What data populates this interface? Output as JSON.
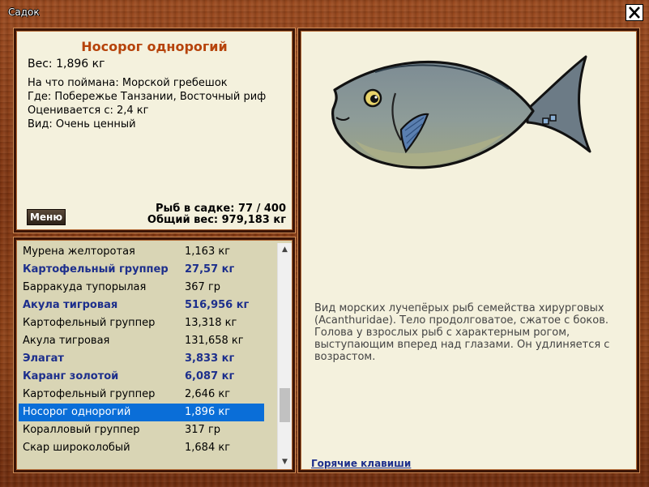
{
  "window": {
    "title": "Садок",
    "close_icon": "close-icon"
  },
  "fish": {
    "name": "Носорог однорогий",
    "weight_label": "Вес: 1,896 кг",
    "details": [
      "На что поймана: Морской гребешок",
      "Где: Побережье Танзании, Восточный риф",
      "Оценивается с: 2,4 кг",
      "Вид: Очень ценный"
    ],
    "description": "Вид морских лучепёрых рыб семейства хирурговых (Acanthuridae). Тело продолговатое, сжатое с боков. Голова у взрослых рыб с характерным рогом, выступающим вперед над глазами. Он удлиняется с возрастом."
  },
  "menu_label": "Меню",
  "stats": {
    "count": "Рыб в садке: 77 / 400",
    "total": "Общий вес: 979,183 кг"
  },
  "catch_list": [
    {
      "name": "Мурена желторотая",
      "weight": "1,163 кг",
      "bold": false,
      "selected": false
    },
    {
      "name": "Картофельный группер",
      "weight": "27,57 кг",
      "bold": true,
      "selected": false
    },
    {
      "name": "Барракуда тупорылая",
      "weight": "367 гр",
      "bold": false,
      "selected": false
    },
    {
      "name": "Акула тигровая",
      "weight": "516,956 кг",
      "bold": true,
      "selected": false
    },
    {
      "name": "Картофельный группер",
      "weight": "13,318 кг",
      "bold": false,
      "selected": false
    },
    {
      "name": "Акула тигровая",
      "weight": "131,658 кг",
      "bold": false,
      "selected": false
    },
    {
      "name": "Элагат",
      "weight": "3,833 кг",
      "bold": true,
      "selected": false
    },
    {
      "name": "Каранг золотой",
      "weight": "6,087 кг",
      "bold": true,
      "selected": false
    },
    {
      "name": "Картофельный группер",
      "weight": "2,646 кг",
      "bold": false,
      "selected": false
    },
    {
      "name": "Носорог однорогий",
      "weight": "1,896 кг",
      "bold": false,
      "selected": true
    },
    {
      "name": "Коралловый группер",
      "weight": "317 гр",
      "bold": false,
      "selected": false
    },
    {
      "name": "Скар широколобый",
      "weight": "1,684 кг",
      "bold": false,
      "selected": false
    }
  ],
  "scroll_position": 0.8,
  "hotkeys_label": "Горячие клавиши",
  "colors": {
    "title": "#b6430b",
    "highlight_row": "#0a6ed8",
    "bold_row": "#1d2f8c",
    "panel_bg": "#f4f1dd"
  }
}
